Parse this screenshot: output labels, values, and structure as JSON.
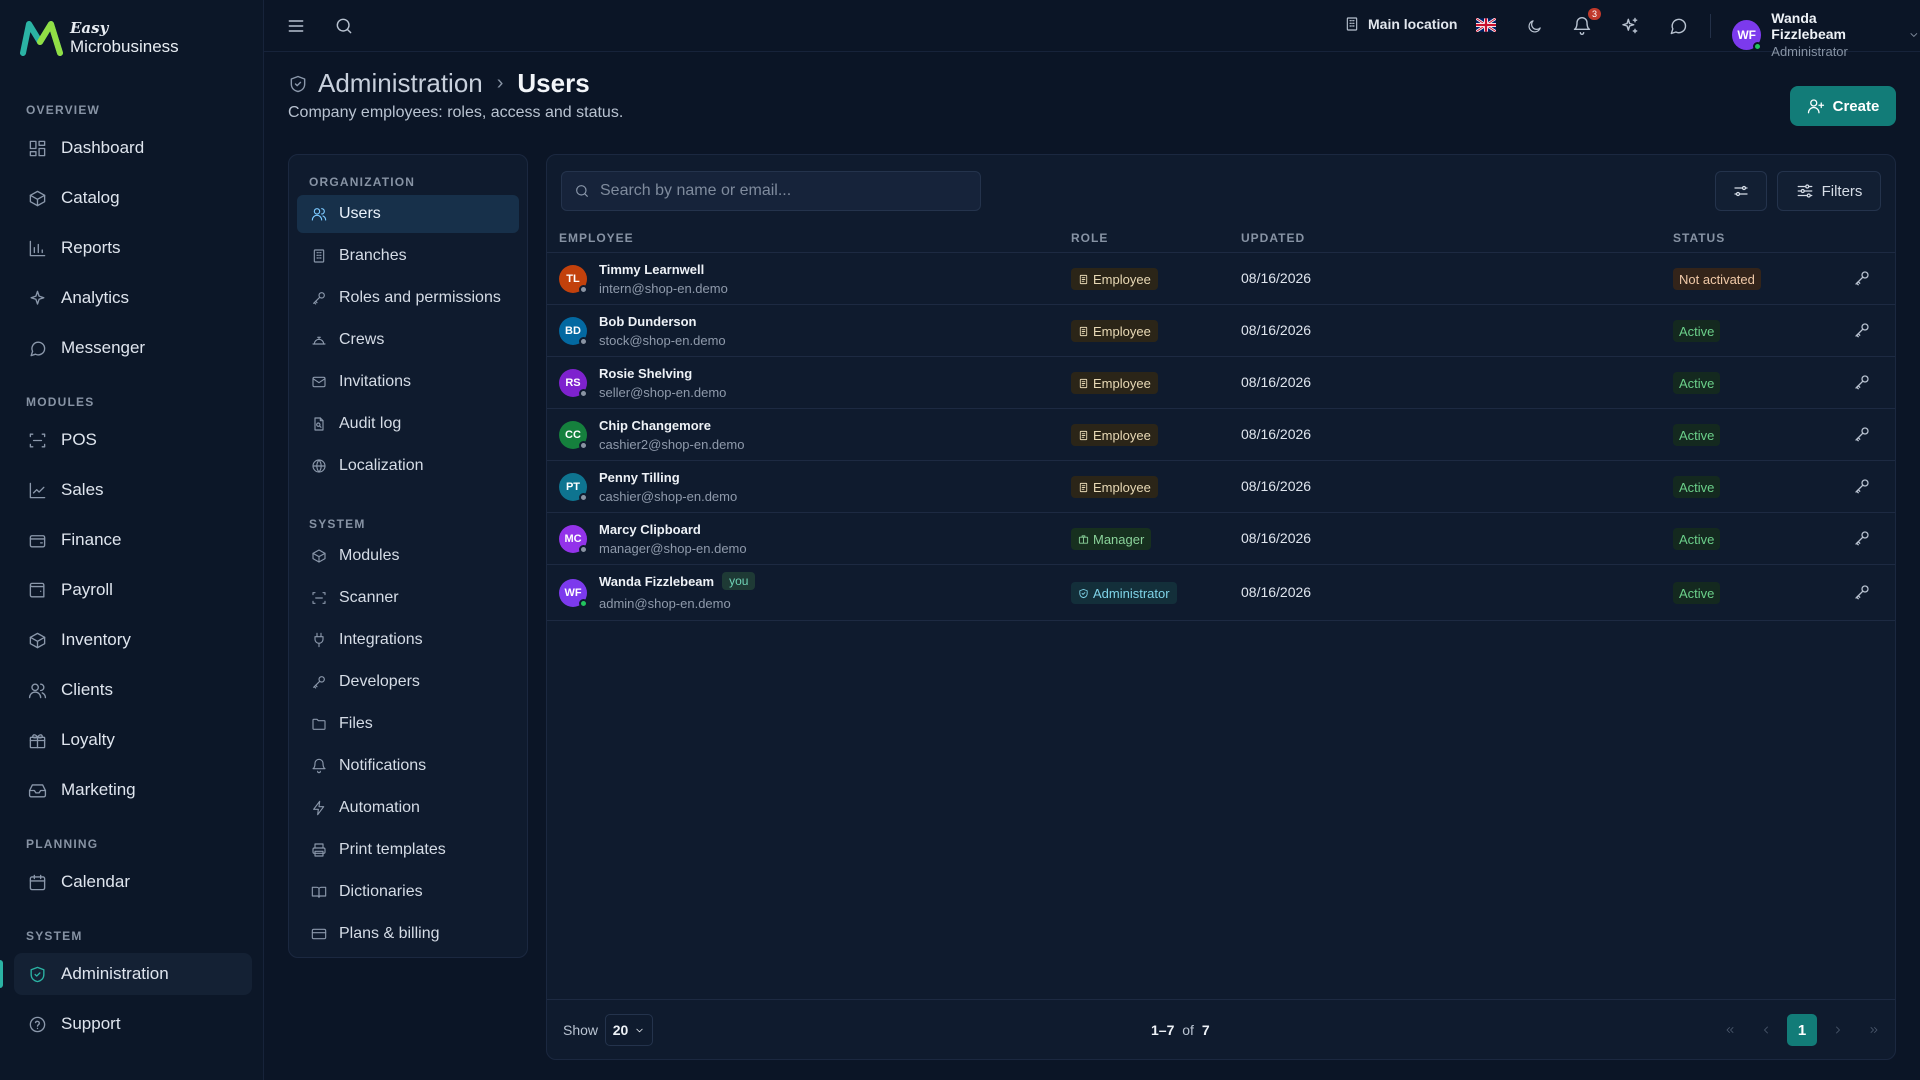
{
  "brand": {
    "top": "Easy",
    "bottom": "Microbusiness"
  },
  "sidebar": {
    "sections": [
      {
        "label": "OVERVIEW"
      },
      {
        "label": "MODULES"
      },
      {
        "label": "PLANNING"
      },
      {
        "label": "SYSTEM"
      }
    ],
    "items": [
      {
        "label": "Dashboard",
        "icon": "dashboard-icon"
      },
      {
        "label": "Catalog",
        "icon": "catalog-icon"
      },
      {
        "label": "Reports",
        "icon": "reports-icon"
      },
      {
        "label": "Analytics",
        "icon": "analytics-icon"
      },
      {
        "label": "Messenger",
        "icon": "messenger-icon"
      },
      {
        "label": "POS",
        "icon": "pos-icon"
      },
      {
        "label": "Sales",
        "icon": "sales-icon"
      },
      {
        "label": "Finance",
        "icon": "finance-icon"
      },
      {
        "label": "Payroll",
        "icon": "payroll-icon"
      },
      {
        "label": "Inventory",
        "icon": "inventory-icon"
      },
      {
        "label": "Clients",
        "icon": "clients-icon"
      },
      {
        "label": "Loyalty",
        "icon": "loyalty-icon"
      },
      {
        "label": "Marketing",
        "icon": "marketing-icon"
      },
      {
        "label": "Calendar",
        "icon": "calendar-icon"
      },
      {
        "label": "Administration",
        "icon": "shield-icon",
        "active": true
      },
      {
        "label": "Support",
        "icon": "help-icon"
      }
    ]
  },
  "topbar": {
    "location": "Main location",
    "notifications_count": "3",
    "user": {
      "initials": "WF",
      "name": "Wanda Fizzlebeam",
      "role": "Administrator"
    }
  },
  "header": {
    "parent": "Administration",
    "separator": "›",
    "current": "Users",
    "subtitle": "Company employees: roles, access and status.",
    "create_label": "Create"
  },
  "subnav": {
    "sections": [
      "ORGANIZATION",
      "SYSTEM"
    ],
    "organization": [
      "Users",
      "Branches",
      "Roles and permissions",
      "Crews",
      "Invitations",
      "Audit log",
      "Localization"
    ],
    "system": [
      "Modules",
      "Scanner",
      "Integrations",
      "Developers",
      "Files",
      "Notifications",
      "Automation",
      "Print templates",
      "Dictionaries",
      "Plans & billing"
    ]
  },
  "table": {
    "search_placeholder": "Search by name or email...",
    "filters_label": "Filters",
    "columns": {
      "employee": "EMPLOYEE",
      "role": "ROLE",
      "updated": "UPDATED",
      "status": "STATUS"
    },
    "you_label": "you",
    "rows": [
      {
        "initials": "TL",
        "color": "#c2410c",
        "name": "Timmy Learnwell",
        "email": "intern@shop-en.demo",
        "role": "Employee",
        "role_type": "employee",
        "updated": "08/16/2026",
        "status": "Not activated",
        "status_type": "inactive",
        "online": false,
        "you": false
      },
      {
        "initials": "BD",
        "color": "#0369a1",
        "name": "Bob Dunderson",
        "email": "stock@shop-en.demo",
        "role": "Employee",
        "role_type": "employee",
        "updated": "08/16/2026",
        "status": "Active",
        "status_type": "active",
        "online": false,
        "you": false
      },
      {
        "initials": "RS",
        "color": "#7e22ce",
        "name": "Rosie Shelving",
        "email": "seller@shop-en.demo",
        "role": "Employee",
        "role_type": "employee",
        "updated": "08/16/2026",
        "status": "Active",
        "status_type": "active",
        "online": false,
        "you": false
      },
      {
        "initials": "CC",
        "color": "#15803d",
        "name": "Chip Changemore",
        "email": "cashier2@shop-en.demo",
        "role": "Employee",
        "role_type": "employee",
        "updated": "08/16/2026",
        "status": "Active",
        "status_type": "active",
        "online": false,
        "you": false
      },
      {
        "initials": "PT",
        "color": "#0e7490",
        "name": "Penny Tilling",
        "email": "cashier@shop-en.demo",
        "role": "Employee",
        "role_type": "employee",
        "updated": "08/16/2026",
        "status": "Active",
        "status_type": "active",
        "online": false,
        "you": false
      },
      {
        "initials": "MC",
        "color": "#9333ea",
        "name": "Marcy Clipboard",
        "email": "manager@shop-en.demo",
        "role": "Manager",
        "role_type": "manager",
        "updated": "08/16/2026",
        "status": "Active",
        "status_type": "active",
        "online": false,
        "you": false
      },
      {
        "initials": "WF",
        "color": "#7c3aed",
        "name": "Wanda Fizzlebeam",
        "email": "admin@shop-en.demo",
        "role": "Administrator",
        "role_type": "admin",
        "updated": "08/16/2026",
        "status": "Active",
        "status_type": "active",
        "online": true,
        "you": true
      }
    ]
  },
  "footer": {
    "show_label": "Show",
    "page_size": "20",
    "range": "1–7",
    "of_label": "of",
    "total": "7",
    "current_page": "1"
  }
}
